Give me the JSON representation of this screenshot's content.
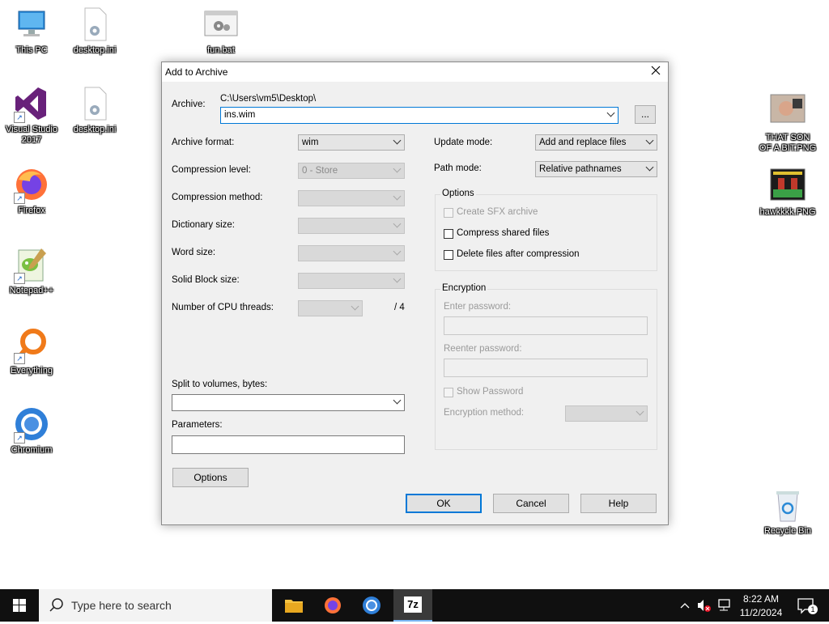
{
  "desktop": {
    "icons": [
      {
        "label": "This PC"
      },
      {
        "label": "desktop.ini"
      },
      {
        "label": "fun.bat"
      },
      {
        "label": "Visual Studio 2017"
      },
      {
        "label": "desktop.ini"
      },
      {
        "label": "Firefox"
      },
      {
        "label": "Notepad++"
      },
      {
        "label": "Everything"
      },
      {
        "label": "Chromium"
      },
      {
        "label": "THAT SON OF A BIT.PNG"
      },
      {
        "label": "hawkkkk.PNG"
      },
      {
        "label": "Recycle Bin"
      }
    ]
  },
  "dialog": {
    "title": "Add to Archive",
    "archive_label": "Archive:",
    "archive_path": "C:\\Users\\vm5\\Desktop\\",
    "archive_name": "ins.wim",
    "browse_label": "...",
    "left": {
      "archive_format_label": "Archive format:",
      "archive_format_value": "wim",
      "compression_level_label": "Compression level:",
      "compression_level_value": "0 - Store",
      "compression_method_label": "Compression method:",
      "dictionary_size_label": "Dictionary size:",
      "word_size_label": "Word size:",
      "solid_block_label": "Solid Block size:",
      "cpu_threads_label": "Number of CPU threads:",
      "cpu_threads_total": "/ 4",
      "split_label": "Split to volumes, bytes:",
      "parameters_label": "Parameters:",
      "options_button": "Options"
    },
    "right": {
      "update_mode_label": "Update mode:",
      "update_mode_value": "Add and replace files",
      "path_mode_label": "Path mode:",
      "path_mode_value": "Relative pathnames",
      "options_group": "Options",
      "create_sfx": "Create SFX archive",
      "compress_shared": "Compress shared files",
      "delete_after": "Delete files after compression",
      "encryption_group": "Encryption",
      "enter_password": "Enter password:",
      "reenter_password": "Reenter password:",
      "show_password": "Show Password",
      "encryption_method": "Encryption method:"
    },
    "buttons": {
      "ok": "OK",
      "cancel": "Cancel",
      "help": "Help"
    }
  },
  "taskbar": {
    "search_placeholder": "Type here to search",
    "time": "8:22 AM",
    "date": "11/2/2024",
    "notification_count": "1",
    "app_7z_label": "7z"
  }
}
